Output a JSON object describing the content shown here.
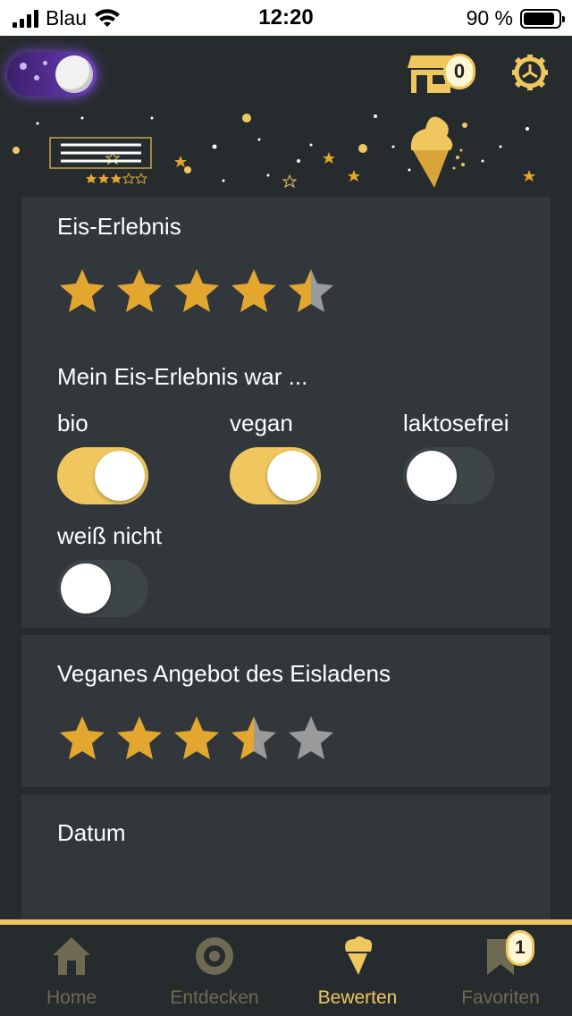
{
  "status_bar": {
    "carrier": "Blau",
    "time": "12:20",
    "battery": "90 %",
    "battery_level": 0.9
  },
  "header": {
    "night_mode_on": true,
    "shop_badge": "0",
    "icons": [
      "moon-toggle-icon",
      "shop-icon",
      "gear-icon",
      "ice-cream-icon"
    ]
  },
  "card_experience": {
    "title": "Eis-Erlebnis",
    "rating": 4.5,
    "max_rating": 5,
    "attributes_title": "Mein Eis-Erlebnis war ...",
    "toggles": [
      {
        "label": "bio",
        "on": true
      },
      {
        "label": "vegan",
        "on": true
      },
      {
        "label": "laktosefrei",
        "on": false
      },
      {
        "label": "weiß nicht",
        "on": false
      }
    ]
  },
  "card_vegan": {
    "title": "Veganes Angebot des Eisladens",
    "rating": 3.5,
    "max_rating": 5
  },
  "card_date": {
    "title": "Datum"
  },
  "tabbar": {
    "tabs": [
      {
        "label": "Home",
        "icon": "home-icon",
        "active": false
      },
      {
        "label": "Entdecken",
        "icon": "target-icon",
        "active": false
      },
      {
        "label": "Bewerten",
        "icon": "ice-cream-icon",
        "active": true
      },
      {
        "label": "Favoriten",
        "icon": "bookmark-icon",
        "active": false
      }
    ],
    "favorites_badge": "1"
  },
  "colors": {
    "accent": "#f0c75e",
    "star_gold": "#e3a62f",
    "star_empty": "#9a9a9a",
    "card_bg": "#31373b",
    "page_bg": "#262b2e"
  }
}
